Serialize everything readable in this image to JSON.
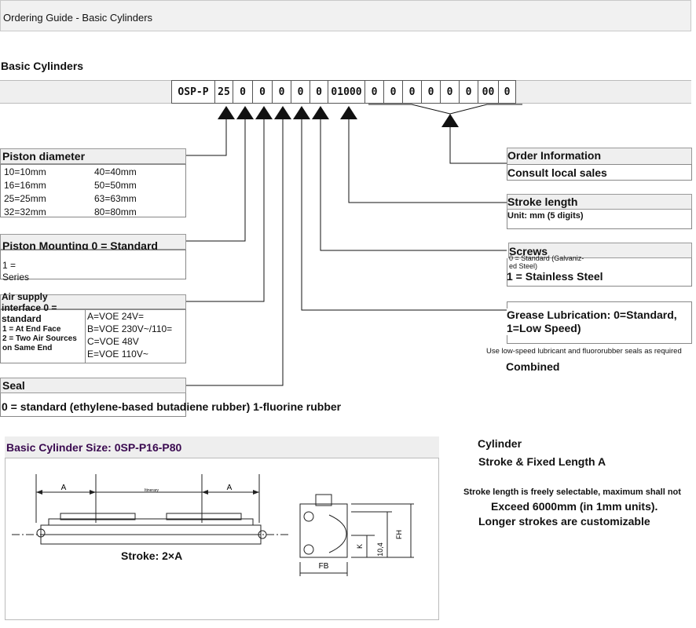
{
  "header": {
    "title": "Ordering Guide - Basic Cylinders"
  },
  "section_title": "Basic Cylinders",
  "code": [
    "OSP-P",
    "25",
    "0",
    "0",
    "0",
    "0",
    "0",
    "01000",
    "0",
    "0",
    "0",
    "0",
    "0",
    "0",
    "00",
    "0"
  ],
  "piston_diameter": {
    "title": "Piston diameter",
    "col1": [
      "10=10mm",
      "16=16mm",
      "25=25mm",
      "32=32mm"
    ],
    "col2": [
      "40=40mm",
      "50=50mm",
      "63=63mm",
      "80=80mm"
    ]
  },
  "piston_mounting": {
    "title": "Piston Mounting 0 = Standard",
    "line1": "1 =",
    "line2": "Series"
  },
  "air_supply": {
    "title_l1": "Air supply",
    "title_l2": "interface 0 =",
    "title_l3": "standard",
    "opt1": "1 = At End Face",
    "opt2a": "2 = Two Air Sources",
    "opt2b": "on Same End",
    "voltages": [
      "A=VOE 24V=",
      "B=VOE 230V~/110=",
      "C=VOE 48V",
      "E=VOE 110V~"
    ]
  },
  "seal": {
    "title": "Seal",
    "desc": "0 = standard (ethylene-based butadiene rubber) 1-fluorine rubber"
  },
  "order_info": {
    "title": "Order Information",
    "desc": "Consult local sales"
  },
  "stroke_length": {
    "title": "Stroke length",
    "unit": "Unit: mm (5 digits)"
  },
  "screws": {
    "title": "Screws",
    "std_a": "0 = Standard (Galvaniz-",
    "std_b": "ed Steel)",
    "stainless": "1 = Stainless Steel"
  },
  "grease": {
    "title_l1": "Grease Lubrication: 0=Standard,",
    "title_l2": "1=Low Speed)",
    "note": "Use low-speed lubricant and fluororubber seals as required",
    "combined": "Combined"
  },
  "size_panel": {
    "title": "Basic Cylinder Size: 0SP-P16-P80"
  },
  "drawing": {
    "dim_a_left": "A",
    "dim_a_right": "A",
    "center_label": "Itinerary",
    "stroke_label": "Stroke: 2×A",
    "fh": "FH",
    "k": "K",
    "dim_104": "10,4",
    "fb": "FB"
  },
  "cylinder_info": {
    "title": "Cylinder",
    "subtitle": "Stroke & Fixed Length A",
    "note": "Stroke length is freely selectable, maximum shall not",
    "max": "Exceed 6000mm (in 1mm units).",
    "custom": "Longer strokes are customizable"
  },
  "colors": {
    "accent": "#3a0a50",
    "band": "#efefef",
    "border": "#888888"
  }
}
